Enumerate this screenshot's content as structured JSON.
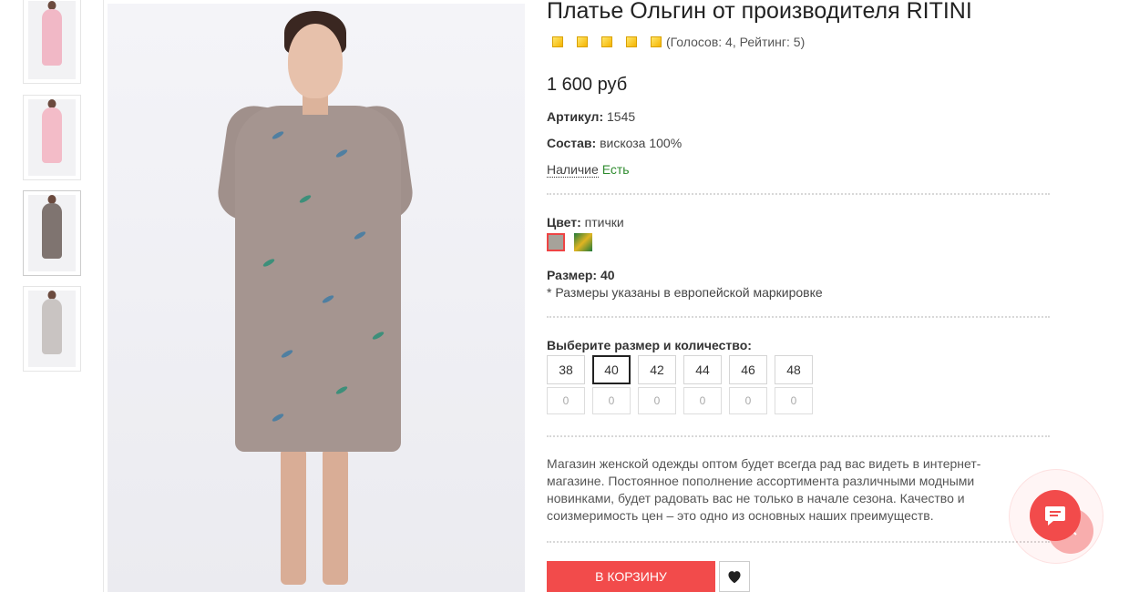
{
  "product": {
    "title": "Платье Ольгин от производителя RITINI",
    "rating": 5,
    "votes_text": "(Голосов: 4, Рейтинг: 5)",
    "price": "1 600 руб",
    "article_label": "Артикул:",
    "article_value": "1545",
    "composition_label": "Состав:",
    "composition_value": "вискоза 100%",
    "availability_label": "Наличие",
    "availability_value": "Есть",
    "color_label": "Цвет:",
    "color_value": "птички",
    "colors": [
      "#a6a29a",
      "#1f7a3a"
    ],
    "size_label": "Размер:",
    "size_value": "40",
    "size_note": "* Размеры указаны в европейской маркировке",
    "choose_label": "Выберите размер и количество:",
    "sizes": [
      {
        "size": "38",
        "qty": "0",
        "selected": false
      },
      {
        "size": "40",
        "qty": "0",
        "selected": true
      },
      {
        "size": "42",
        "qty": "0",
        "selected": false
      },
      {
        "size": "44",
        "qty": "0",
        "selected": false
      },
      {
        "size": "46",
        "qty": "0",
        "selected": false
      },
      {
        "size": "48",
        "qty": "0",
        "selected": false
      }
    ],
    "description": "Магазин женской одежды оптом будет всегда рад вас видеть в интернет-магазине. Постоянное пополнение ассортимента различными модными новинками, будет радовать вас не только в начале сезона. Качество и соизмеримость цен – это одно из основных наших преимуществ.",
    "cart_button": "В КОРЗИНУ"
  },
  "thumbnails": [
    {
      "dress_color": "#f1b8c6"
    },
    {
      "dress_color": "#f3bcc8"
    },
    {
      "dress_color": "#7f7470"
    },
    {
      "dress_color": "#c9c4c2"
    }
  ],
  "colors_ui": {
    "accent": "#f24b4b",
    "available": "#2e8b2e",
    "star": "#f5b400"
  },
  "icons": {
    "favorite": "heart-icon",
    "chat": "chat-icon",
    "up": "arrow-up-icon"
  }
}
